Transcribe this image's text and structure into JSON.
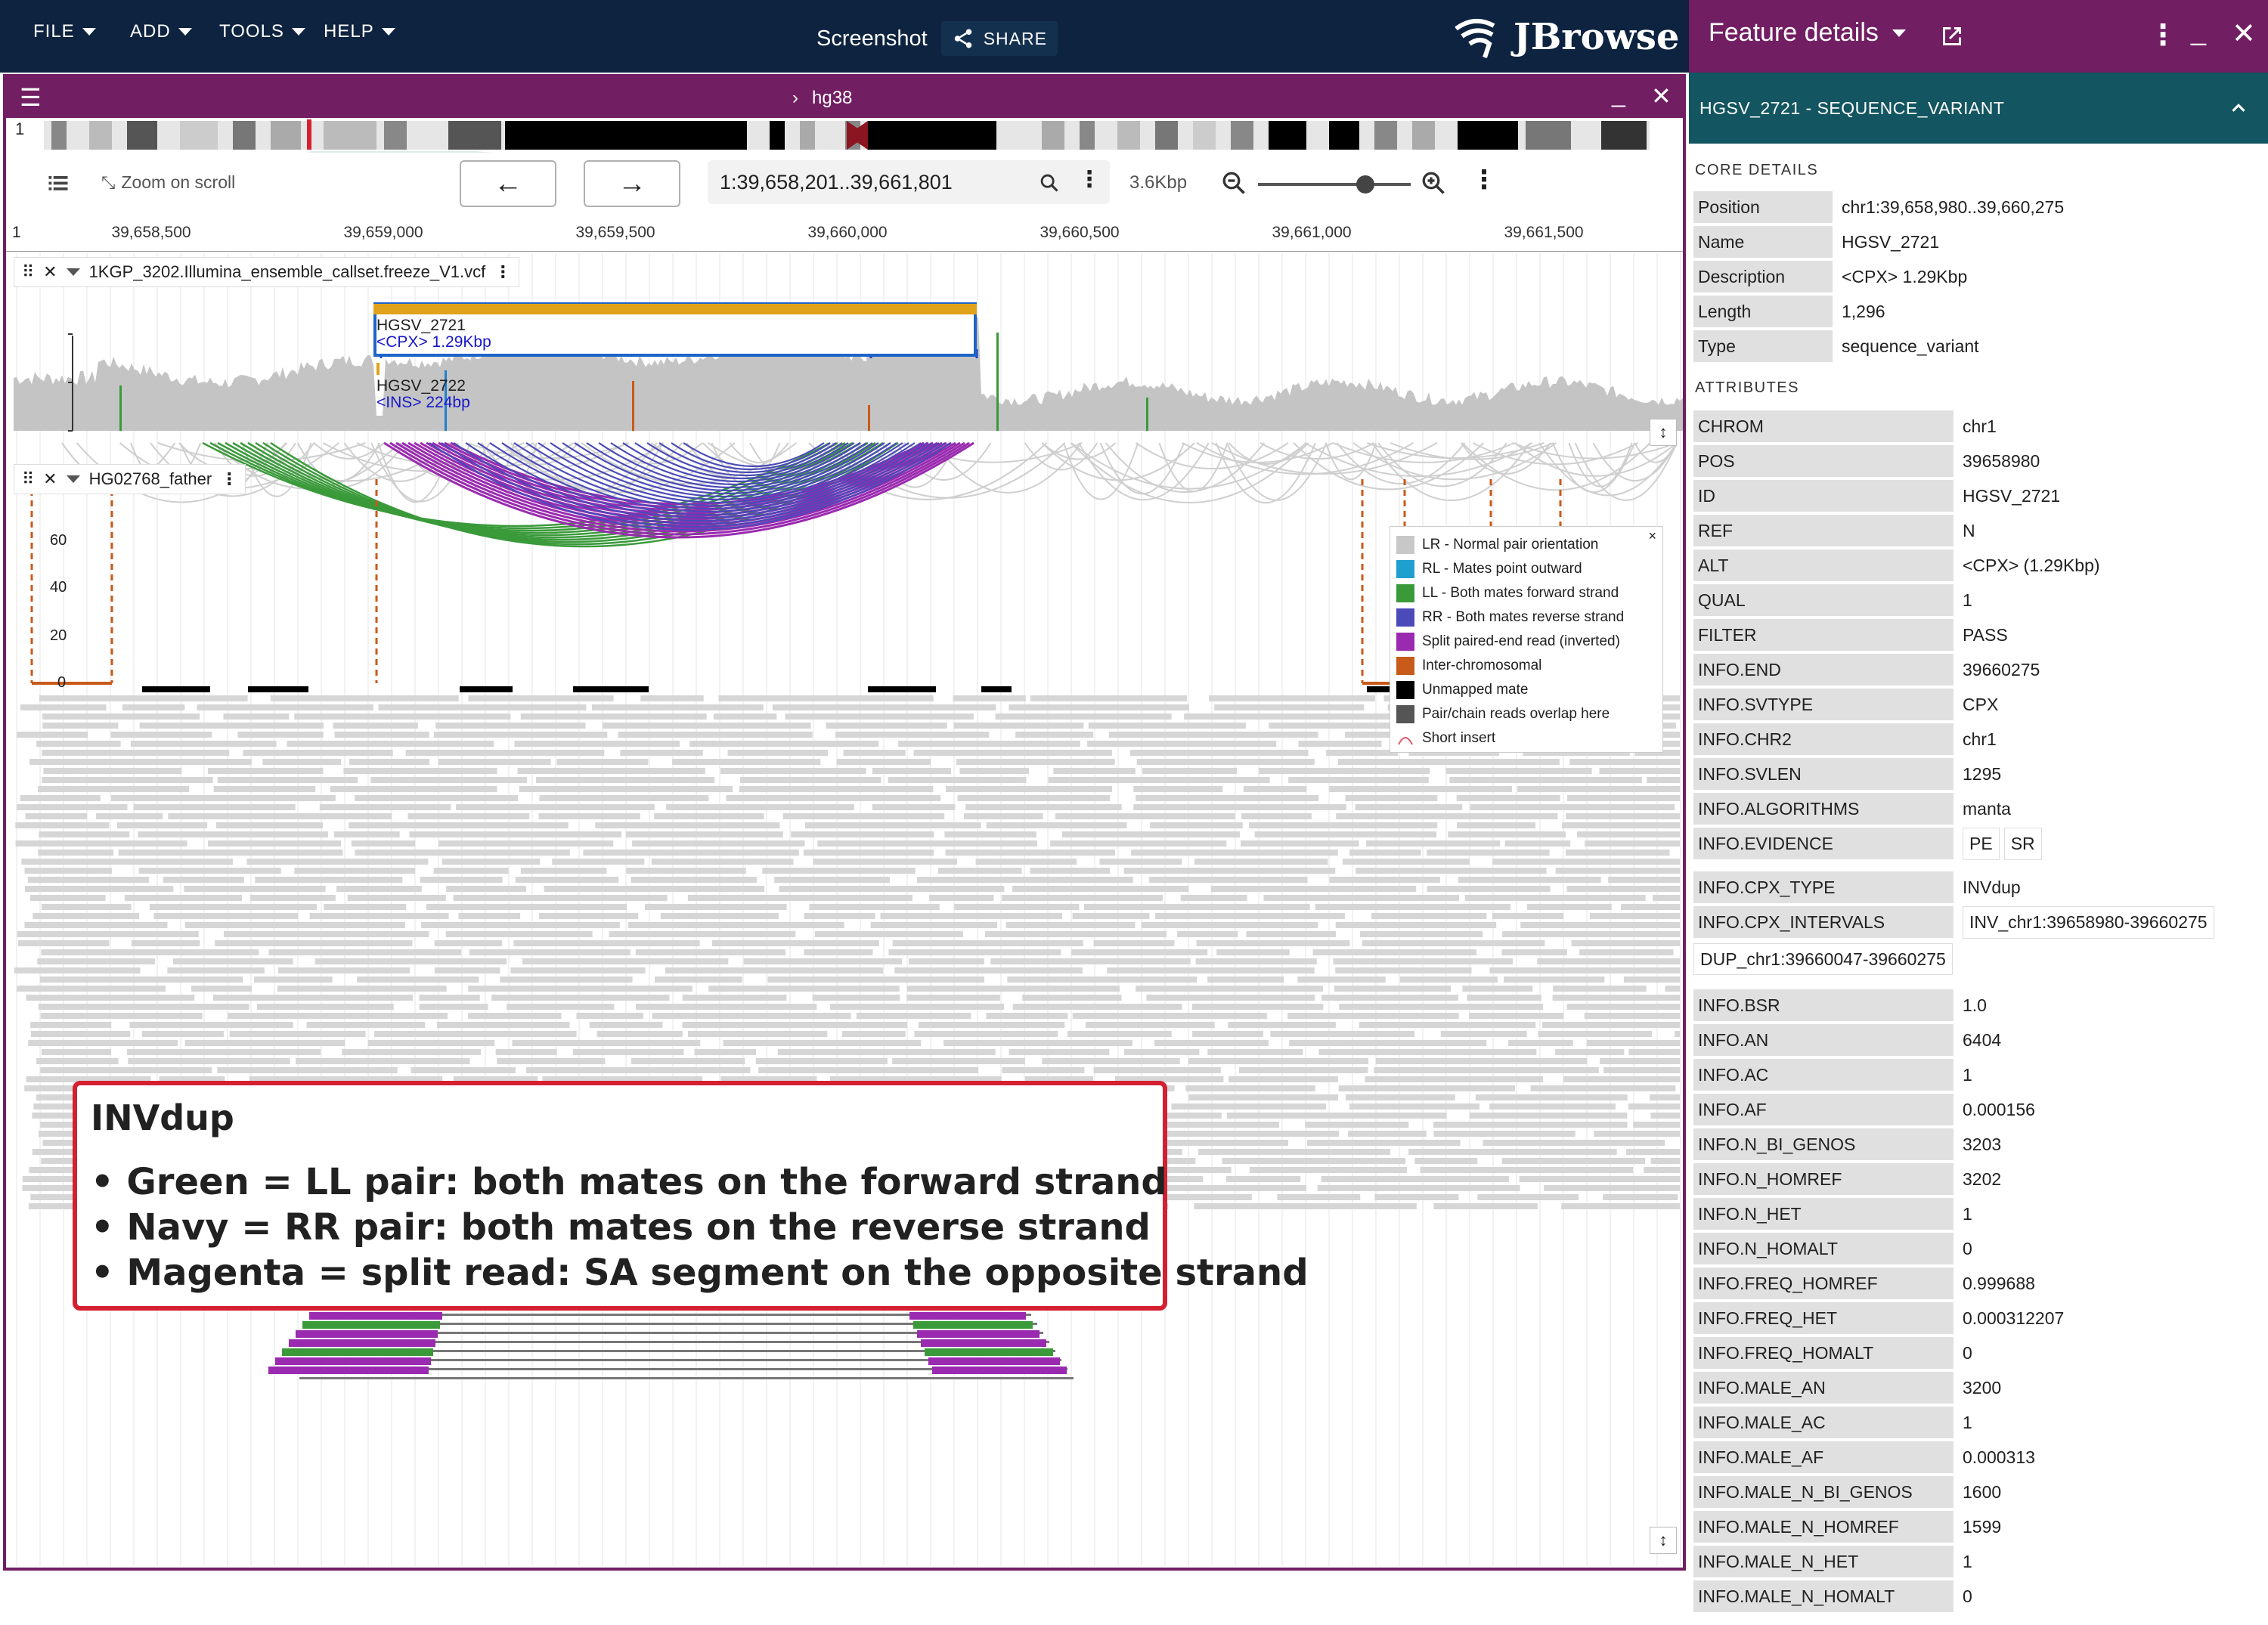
{
  "appbar": {
    "menus": [
      "FILE",
      "ADD",
      "TOOLS",
      "HELP"
    ],
    "session_title": "Screenshot",
    "share_label": "SHARE",
    "logo_text": "JBrowse"
  },
  "drawer": {
    "title": "Feature details",
    "subtitle": "HGSV_2721 - SEQUENCE_VARIANT",
    "core_title": "CORE DETAILS",
    "core": [
      {
        "key": "Position",
        "value": "chr1:39,658,980..39,660,275"
      },
      {
        "key": "Name",
        "value": "HGSV_2721"
      },
      {
        "key": "Description",
        "value": "<CPX> 1.29Kbp"
      },
      {
        "key": "Length",
        "value": "1,296"
      },
      {
        "key": "Type",
        "value": "sequence_variant"
      }
    ],
    "attributes_title": "ATTRIBUTES",
    "attributes": [
      {
        "key": "CHROM",
        "value": "chr1"
      },
      {
        "key": "POS",
        "value": "39658980"
      },
      {
        "key": "ID",
        "value": "HGSV_2721"
      },
      {
        "key": "REF",
        "value": "N"
      },
      {
        "key": "ALT",
        "value": "<CPX> (1.29Kbp)"
      },
      {
        "key": "QUAL",
        "value": "1"
      },
      {
        "key": "FILTER",
        "value": "PASS"
      },
      {
        "key": "INFO.END",
        "value": "39660275"
      },
      {
        "key": "INFO.SVTYPE",
        "value": "CPX"
      },
      {
        "key": "INFO.CHR2",
        "value": "chr1"
      },
      {
        "key": "INFO.SVLEN",
        "value": "1295"
      },
      {
        "key": "INFO.ALGORITHMS",
        "value": "manta"
      }
    ],
    "evidence_key": "INFO.EVIDENCE",
    "evidence_chips": [
      "PE",
      "SR"
    ],
    "cpx_type_key": "INFO.CPX_TYPE",
    "cpx_type_value": "INVdup",
    "cpx_intervals_key": "INFO.CPX_INTERVALS",
    "cpx_intervals_chip1": "INV_chr1:39658980-39660275",
    "cpx_intervals_chip2": "DUP_chr1:39660047-39660275",
    "attributes2": [
      {
        "key": "INFO.BSR",
        "value": "1.0"
      },
      {
        "key": "INFO.AN",
        "value": "6404"
      },
      {
        "key": "INFO.AC",
        "value": "1"
      },
      {
        "key": "INFO.AF",
        "value": "0.000156"
      },
      {
        "key": "INFO.N_BI_GENOS",
        "value": "3203"
      },
      {
        "key": "INFO.N_HOMREF",
        "value": "3202"
      },
      {
        "key": "INFO.N_HET",
        "value": "1"
      },
      {
        "key": "INFO.N_HOMALT",
        "value": "0"
      },
      {
        "key": "INFO.FREQ_HOMREF",
        "value": "0.999688"
      },
      {
        "key": "INFO.FREQ_HET",
        "value": "0.000312207"
      },
      {
        "key": "INFO.FREQ_HOMALT",
        "value": "0"
      },
      {
        "key": "INFO.MALE_AN",
        "value": "3200"
      },
      {
        "key": "INFO.MALE_AC",
        "value": "1"
      },
      {
        "key": "INFO.MALE_AF",
        "value": "0.000313"
      },
      {
        "key": "INFO.MALE_N_BI_GENOS",
        "value": "1600"
      },
      {
        "key": "INFO.MALE_N_HOMREF",
        "value": "1599"
      },
      {
        "key": "INFO.MALE_N_HET",
        "value": "1"
      },
      {
        "key": "INFO.MALE_N_HOMALT",
        "value": "0"
      }
    ]
  },
  "view": {
    "assembly": "hg38",
    "chrom_label": "1",
    "zoom_on_scroll": "Zoom on scroll",
    "location": "1:39,658,201..39,661,801",
    "span": "3.6Kbp",
    "ruler_start": "1",
    "ruler_ticks": [
      "39,658,500",
      "39,659,000",
      "39,659,500",
      "39,660,000",
      "39,660,500",
      "39,661,000",
      "39,661,500"
    ]
  },
  "vcf_track": {
    "name": "1KGP_3202.Illumina_ensemble_callset.freeze_V1.vcf",
    "feature1_name": "HGSV_2721",
    "feature1_desc": "<CPX> 1.29Kbp",
    "feature2_name": "HGSV_2722",
    "feature2_desc": "<INS> 224bp"
  },
  "alignment_track": {
    "name": "HG02768_father",
    "y_ticks": [
      "60",
      "40",
      "20",
      "0"
    ]
  },
  "legend": [
    {
      "label": "LR - Normal pair orientation",
      "color": "#c8c8c8"
    },
    {
      "label": "RL - Mates point outward",
      "color": "#1f9fd0"
    },
    {
      "label": "LL - Both mates forward strand",
      "color": "#3a9a3a"
    },
    {
      "label": "RR - Both mates reverse strand",
      "color": "#4a4ab8"
    },
    {
      "label": "Split paired-end read (inverted)",
      "color": "#9a2ab0"
    },
    {
      "label": "Inter-chromosomal",
      "color": "#c85a1a"
    },
    {
      "label": "Unmapped mate",
      "color": "#000000"
    },
    {
      "label": "Pair/chain reads overlap here",
      "color": "#555555"
    },
    {
      "label": "Short insert",
      "color": "#e05a6a"
    }
  ],
  "legend_close": "×",
  "annotation": {
    "title": "INVdup",
    "lines": [
      "• Green = LL pair: both mates on the forward strand",
      "• Navy = RR pair: both mates on the reverse strand",
      "• Magenta = split read: SA segment on the opposite strand"
    ]
  },
  "colors": {
    "appbar": "#0d233f",
    "accent": "#721e63",
    "drawer_sub": "#135560",
    "feature_bar": "#e0a21b",
    "annotation_border": "#d42030"
  }
}
